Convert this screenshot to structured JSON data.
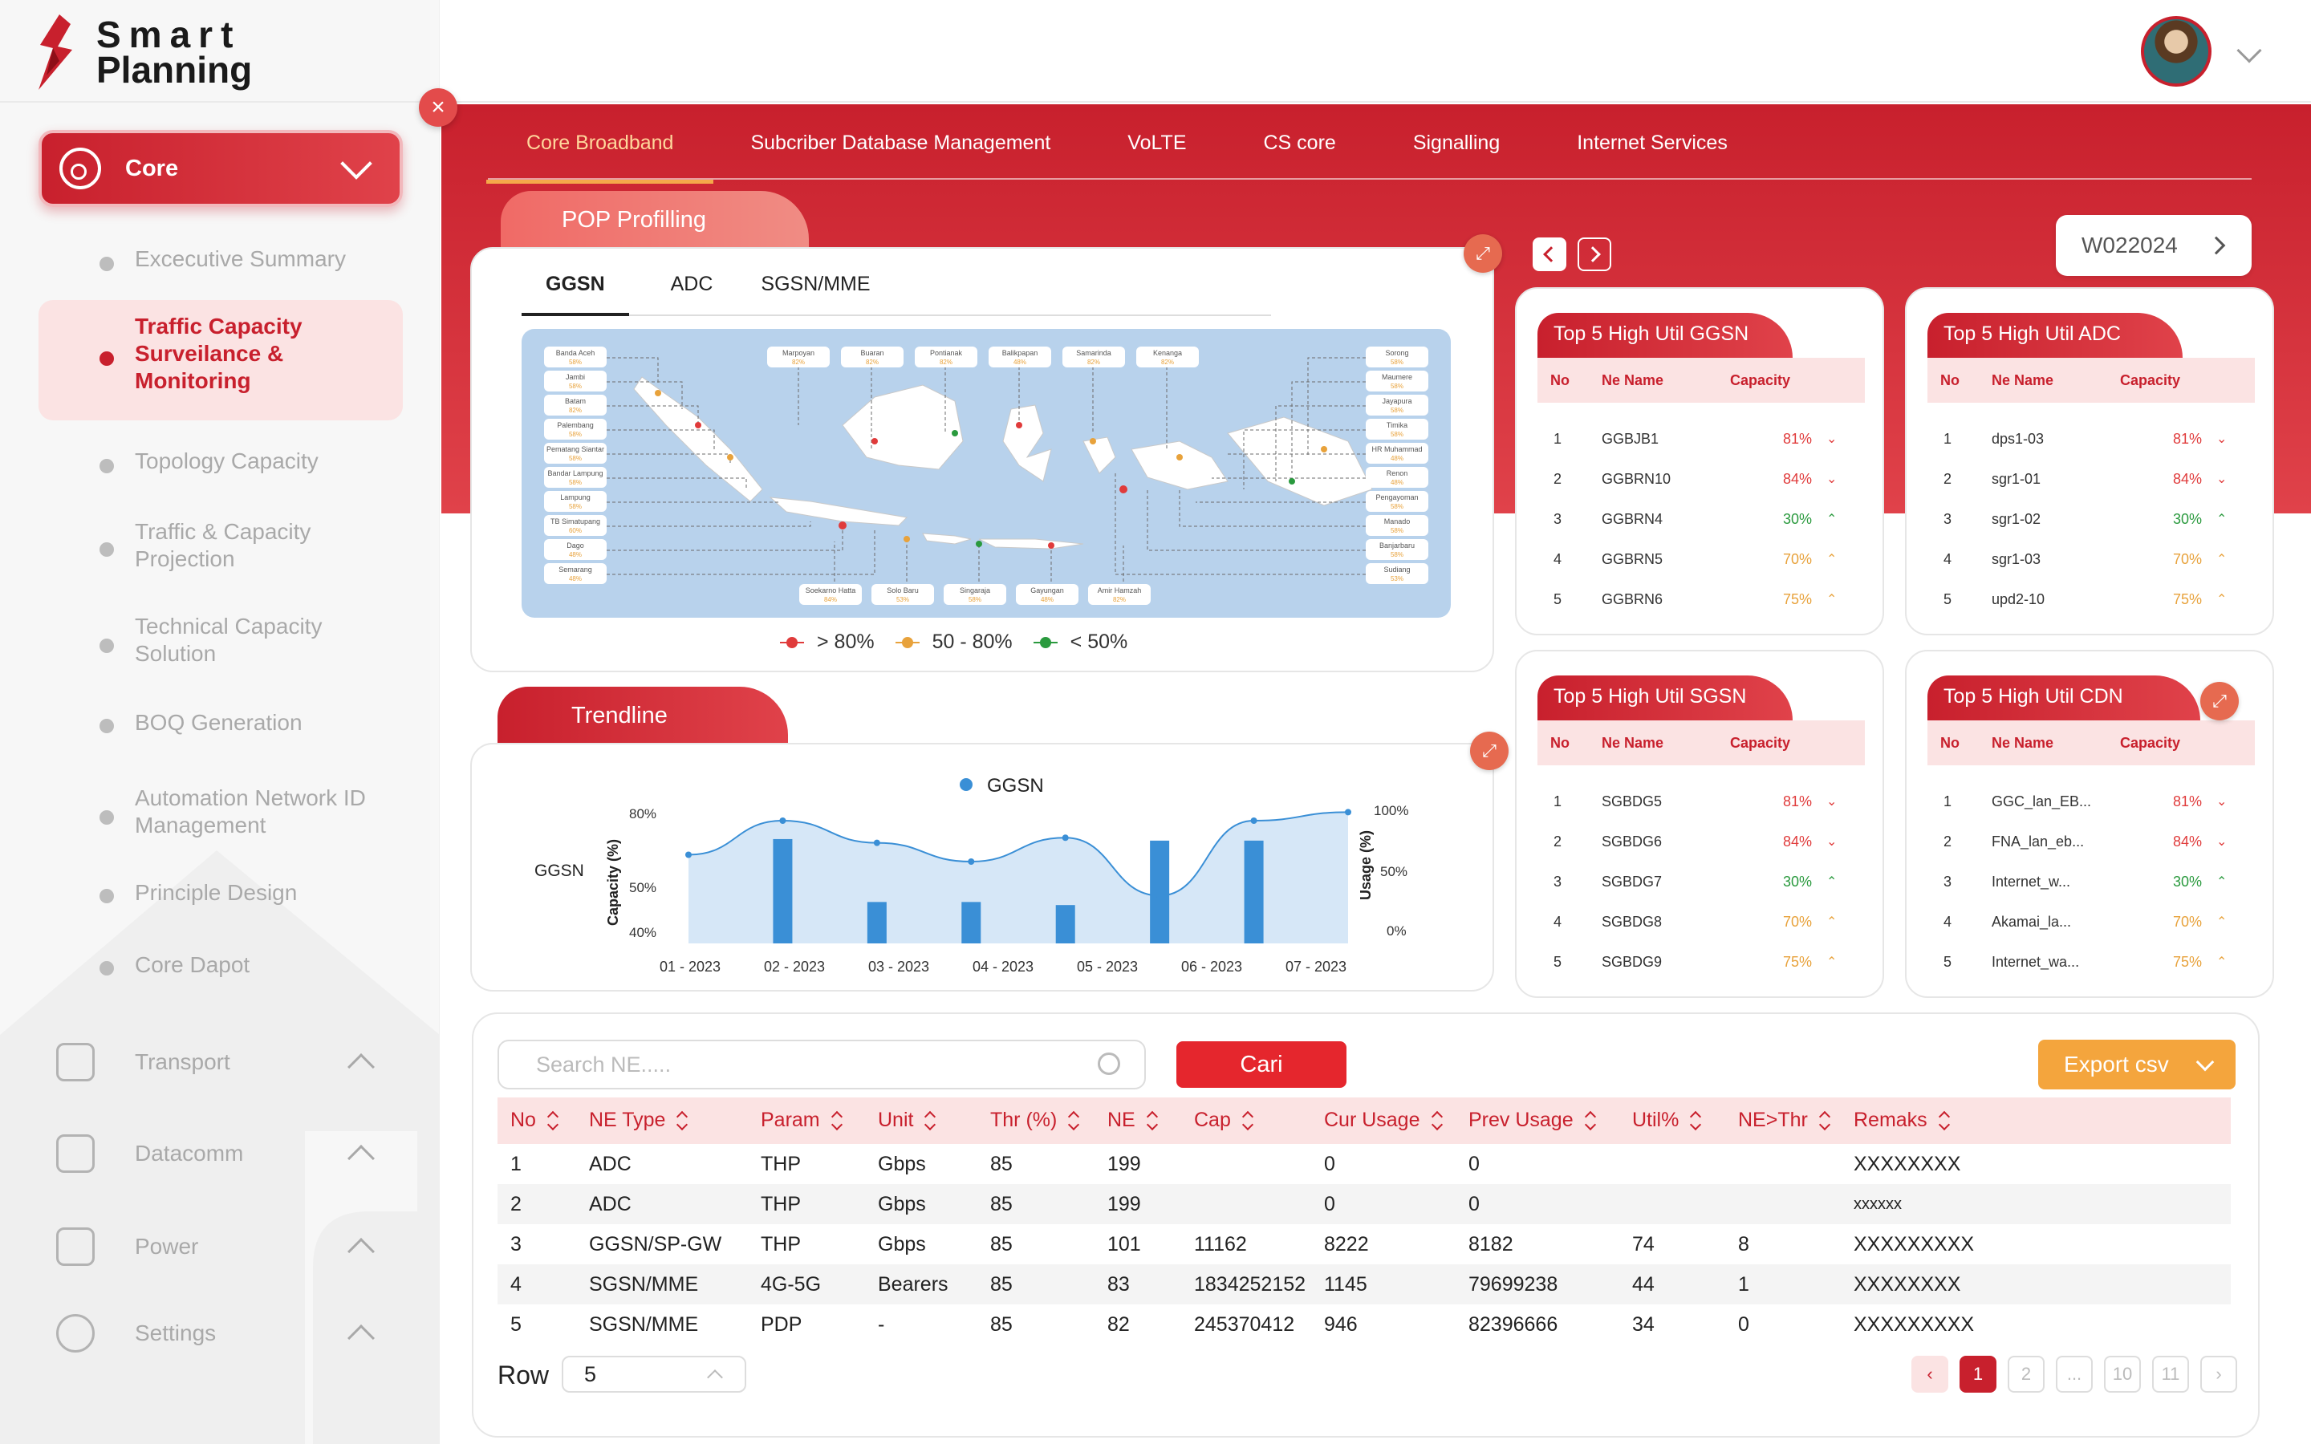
{
  "app": {
    "logo_line1": "Smart",
    "logo_line2": "Planning"
  },
  "sidebar": {
    "core_label": "Core",
    "submenu": [
      {
        "label": "Excecutive Summary"
      },
      {
        "label": "Traffic Capacity Surveilance & Monitoring",
        "active": true
      },
      {
        "label": "Topology Capacity"
      },
      {
        "label": "Traffic & Capacity Projection"
      },
      {
        "label": "Technical Capacity Solution"
      },
      {
        "label": "BOQ Generation"
      },
      {
        "label": "Automation Network ID Management"
      },
      {
        "label": "Principle Design"
      },
      {
        "label": "Core Dapot"
      }
    ],
    "menus": [
      {
        "label": "Transport",
        "icon": "transport-icon"
      },
      {
        "label": "Datacomm",
        "icon": "datacomm-icon"
      },
      {
        "label": "Power",
        "icon": "power-icon"
      },
      {
        "label": "Settings",
        "icon": "gear-icon"
      }
    ]
  },
  "tabs": [
    "Core Broadband",
    "Subcriber Database Management",
    "VoLTE",
    "CS core",
    "Signalling",
    "Internet Services"
  ],
  "pop": {
    "title": "POP Profilling",
    "subtabs": [
      "GGSN",
      "ADC",
      "SGSN/MME"
    ],
    "legend": [
      "> 80%",
      "50 - 80%",
      "< 50%"
    ]
  },
  "map_labels_left": [
    {
      "name": "Banda Aceh",
      "pct": "58%"
    },
    {
      "name": "Jambi",
      "pct": "58%"
    },
    {
      "name": "Batam",
      "pct": "82%"
    },
    {
      "name": "Palembang",
      "pct": "58%"
    },
    {
      "name": "Pematang Siantar",
      "pct": "58%"
    },
    {
      "name": "Bandar Lampung",
      "pct": "58%"
    },
    {
      "name": "Lampung",
      "pct": "58%"
    },
    {
      "name": "TB Simatupang",
      "pct": "60%"
    },
    {
      "name": "Dago",
      "pct": "48%"
    },
    {
      "name": "Semarang",
      "pct": "48%"
    }
  ],
  "map_labels_top": [
    {
      "name": "Marpoyan",
      "pct": "82%"
    },
    {
      "name": "Buaran",
      "pct": "82%"
    },
    {
      "name": "Pontianak",
      "pct": "82%"
    },
    {
      "name": "Balikpapan",
      "pct": "48%"
    },
    {
      "name": "Samarinda",
      "pct": "82%"
    },
    {
      "name": "Kenanga",
      "pct": "82%"
    }
  ],
  "map_labels_right": [
    {
      "name": "Sorong",
      "pct": "58%"
    },
    {
      "name": "Maumere",
      "pct": "58%"
    },
    {
      "name": "Jayapura",
      "pct": "58%"
    },
    {
      "name": "Timika",
      "pct": "58%"
    },
    {
      "name": "HR Muhammad",
      "pct": "48%"
    },
    {
      "name": "Renon",
      "pct": "48%"
    },
    {
      "name": "Pengayoman",
      "pct": "58%"
    },
    {
      "name": "Manado",
      "pct": "58%"
    },
    {
      "name": "Banjarbaru",
      "pct": "58%"
    },
    {
      "name": "Sudiang",
      "pct": "53%"
    }
  ],
  "map_labels_bottom": [
    {
      "name": "Soekarno Hatta",
      "pct": "84%"
    },
    {
      "name": "Solo Baru",
      "pct": "53%"
    },
    {
      "name": "Singaraja",
      "pct": "58%"
    },
    {
      "name": "Gayungan",
      "pct": "48%"
    },
    {
      "name": "Amir Hamzah",
      "pct": "82%"
    }
  ],
  "trend": {
    "title": "Trendline",
    "legend": "GGSN",
    "left_side": "GGSN",
    "ylabel_left": "Capacity (%)",
    "ylabel_right": "Usage (%)",
    "left_ticks": [
      "80%",
      "50%",
      "40%"
    ],
    "right_ticks": [
      "100%",
      "50%",
      "0%"
    ]
  },
  "chart_data": {
    "type": "line",
    "categories": [
      "01 - 2023",
      "02 - 2023",
      "03 - 2023",
      "04 - 2023",
      "05 - 2023",
      "06 - 2023",
      "07 - 2023"
    ],
    "series": [
      {
        "name": "GGSN",
        "values": [
          52,
          72,
          59,
          48,
          62,
          28,
          72,
          77
        ]
      }
    ],
    "bars": [
      0,
      68,
      27,
      27,
      25,
      67,
      67,
      0
    ],
    "ylabel": "Capacity (%)",
    "y2label": "Usage (%)"
  },
  "week": {
    "value": "W022024"
  },
  "top5": [
    {
      "title": "Top 5  High Util GGSN",
      "rows": [
        [
          "1",
          "GGBJB1",
          "81%",
          "red"
        ],
        [
          "2",
          "GGBRN10",
          "84%",
          "red"
        ],
        [
          "3",
          "GGBRN4",
          "30%",
          "grn"
        ],
        [
          "4",
          "GGBRN5",
          "70%",
          "org"
        ],
        [
          "5",
          "GGBRN6",
          "75%",
          "org"
        ]
      ]
    },
    {
      "title": "Top 5  High Util ADC",
      "rows": [
        [
          "1",
          "dps1-03",
          "81%",
          "red"
        ],
        [
          "2",
          "sgr1-01",
          "84%",
          "red"
        ],
        [
          "3",
          "sgr1-02",
          "30%",
          "grn"
        ],
        [
          "4",
          "sgr1-03",
          "70%",
          "org"
        ],
        [
          "5",
          "upd2-10",
          "75%",
          "org"
        ]
      ]
    },
    {
      "title": "Top 5  High Util SGSN",
      "rows": [
        [
          "1",
          "SGBDG5",
          "81%",
          "red"
        ],
        [
          "2",
          "SGBDG6",
          "84%",
          "red"
        ],
        [
          "3",
          "SGBDG7",
          "30%",
          "grn"
        ],
        [
          "4",
          "SGBDG8",
          "70%",
          "org"
        ],
        [
          "5",
          "SGBDG9",
          "75%",
          "org"
        ]
      ]
    },
    {
      "title": "Top 5  High Util CDN",
      "rows": [
        [
          "1",
          "GGC_lan_EB...",
          "81%",
          "red"
        ],
        [
          "2",
          "FNA_lan_eb...",
          "84%",
          "red"
        ],
        [
          "3",
          "Internet_w...",
          "30%",
          "grn"
        ],
        [
          "4",
          "Akamai_la...",
          "70%",
          "org"
        ],
        [
          "5",
          "Internet_wa...",
          "75%",
          "org"
        ]
      ]
    }
  ],
  "top5_cols": [
    "No",
    "Ne Name",
    "Capacity"
  ],
  "table": {
    "search_placeholder": "Search NE.....",
    "search_btn": "Cari",
    "export_btn": "Export csv",
    "columns": [
      "No",
      "NE Type",
      "Param",
      "Unit",
      "Thr (%)",
      "NE",
      "Cap",
      "Cur Usage",
      "Prev Usage",
      "Util%",
      "NE>Thr",
      "Remaks"
    ],
    "rows": [
      [
        "1",
        "ADC",
        "THP",
        "Gbps",
        "85",
        "199",
        "",
        "0",
        "0",
        "",
        "",
        "XXXXXXXX"
      ],
      [
        "2",
        "ADC",
        "THP",
        "Gbps",
        "85",
        "199",
        "",
        "0",
        "0",
        "",
        "",
        "xxxxxx"
      ],
      [
        "3",
        "GGSN/SP-GW",
        "THP",
        "Gbps",
        "85",
        "101",
        "11162",
        "8222",
        "8182",
        "74",
        "8",
        "XXXXXXXXX"
      ],
      [
        "4",
        "SGSN/MME",
        "4G-5G",
        "Bearers",
        "85",
        "83",
        "1834252152",
        "1145",
        "79699238",
        "44",
        "1",
        "XXXXXXXX"
      ],
      [
        "5",
        "SGSN/MME",
        "PDP",
        "-",
        "85",
        "82",
        "245370412",
        "946",
        "82396666",
        "34",
        "0",
        "XXXXXXXXX"
      ]
    ],
    "row_label": "Row",
    "row_value": "5",
    "pages": [
      "1",
      "2",
      "...",
      "10",
      "11"
    ]
  }
}
